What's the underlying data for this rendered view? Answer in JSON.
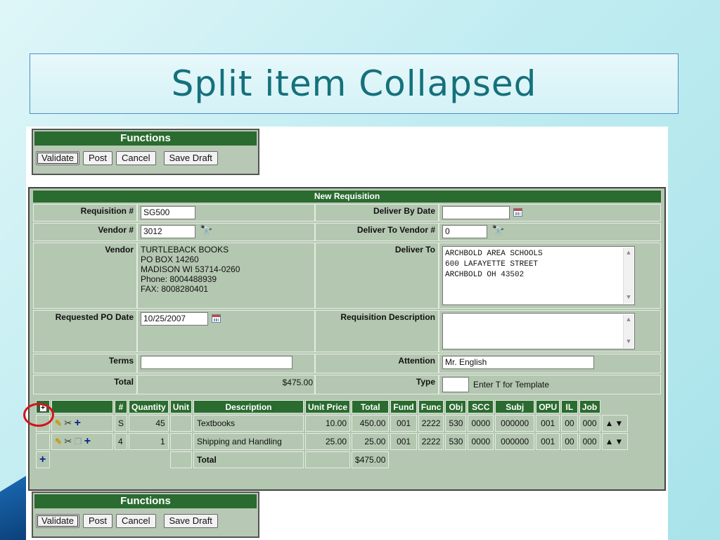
{
  "slide": {
    "title": "Split item Collapsed"
  },
  "functions": {
    "title": "Functions",
    "buttons": [
      "Validate",
      "Post",
      "Cancel",
      "Save Draft"
    ]
  },
  "requisition": {
    "title": "New Requisition",
    "labels": {
      "requisition_no": "Requisition #",
      "deliver_by_date": "Deliver By Date",
      "vendor_no": "Vendor #",
      "deliver_to_vendor_no": "Deliver To Vendor #",
      "vendor": "Vendor",
      "deliver_to": "Deliver To",
      "requested_po_date": "Requested PO Date",
      "requisition_description": "Requisition Description",
      "terms": "Terms",
      "attention": "Attention",
      "total": "Total",
      "type": "Type"
    },
    "values": {
      "requisition_no": "SG500",
      "deliver_by_date": "",
      "vendor_no": "3012",
      "deliver_to_vendor_no": "0",
      "vendor_address": [
        "TURTLEBACK BOOKS",
        "PO BOX 14260",
        "MADISON WI 53714-0260",
        "Phone: 8004488939",
        "FAX: 8008280401"
      ],
      "deliver_to_address": [
        "ARCHBOLD AREA SCHOOLS",
        "600 LAFAYETTE STREET",
        "ARCHBOLD OH 43502"
      ],
      "requested_po_date": "10/25/2007",
      "requisition_description": "",
      "terms": "",
      "attention": "Mr. English",
      "total": "$475.00",
      "type": "",
      "type_note": "Enter T for Template"
    }
  },
  "lines": {
    "expand_icon": "+",
    "headers": [
      "#",
      "Quantity",
      "Unit",
      "Description",
      "Unit Price",
      "Total",
      "Fund",
      "Func",
      "Obj",
      "SCC",
      "Subj",
      "OPU",
      "IL",
      "Job"
    ],
    "rows": [
      {
        "no": "S",
        "quantity": "45",
        "unit": "",
        "description": "Textbooks",
        "unit_price": "10.00",
        "total": "450.00",
        "fund": "001",
        "func": "2222",
        "obj": "530",
        "scc": "0000",
        "subj": "000000",
        "opu": "001",
        "il": "00",
        "job": "000"
      },
      {
        "no": "4",
        "quantity": "1",
        "unit": "",
        "description": "Shipping and Handling",
        "unit_price": "25.00",
        "total": "25.00",
        "fund": "001",
        "func": "2222",
        "obj": "530",
        "scc": "0000",
        "subj": "000000",
        "opu": "001",
        "il": "00",
        "job": "000"
      }
    ],
    "total_label": "Total",
    "total_value": "$475.00",
    "add_icon": "+"
  },
  "icons": {
    "edit": "pencil-icon",
    "cut": "scissors-icon",
    "copy": "copy-icon",
    "add": "plus-icon",
    "lookup": "binoculars-icon",
    "calendar": "calendar-icon",
    "move": "up-down-arrows-icon"
  },
  "colors": {
    "header_green": "#2a6b2f",
    "panel_bg": "#b4c7b1",
    "title_teal": "#14717c",
    "highlight_ring": "#d4141c"
  }
}
